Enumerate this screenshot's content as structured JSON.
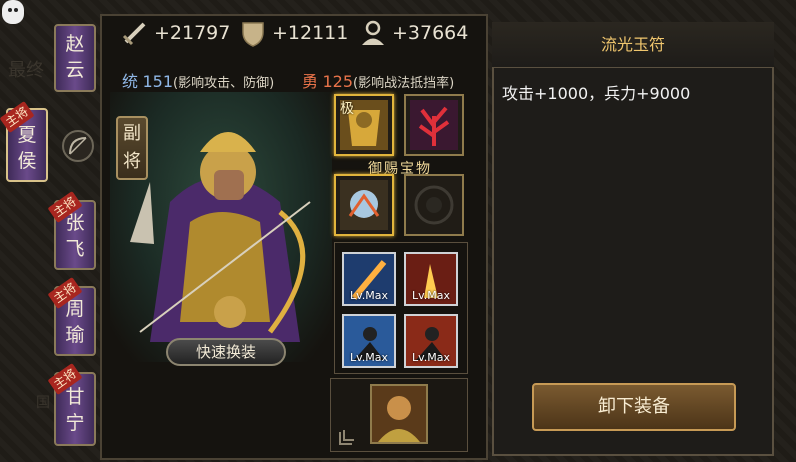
{
  "stats": {
    "attack": "+21797",
    "defense": "+12111",
    "troops": "+37664"
  },
  "attributes": {
    "command_label": "统",
    "command_value": "151",
    "command_desc": "(影响攻击、防御)",
    "valor_label": "勇",
    "valor_value": "125",
    "valor_desc": "(影响战法抵挡率)"
  },
  "sidebar": {
    "heroes": [
      {
        "name_top": "赵",
        "name_bottom": "云",
        "badge": ""
      },
      {
        "name_top": "夏",
        "name_bottom": "侯",
        "badge": "主将"
      },
      {
        "name_top": "张",
        "name_bottom": "飞",
        "badge": "主将"
      },
      {
        "name_top": "周",
        "name_bottom": "瑜",
        "badge": "主将"
      },
      {
        "name_top": "甘",
        "name_bottom": "宁",
        "badge": "主将"
      }
    ]
  },
  "background_text": {
    "word1": "最终",
    "word2": "国"
  },
  "hero": {
    "role_top": "副",
    "role_bottom": "将",
    "quick_equip_label": "快速换装"
  },
  "treasure": {
    "section_label": "御赐宝物",
    "top_slot_badge": "极"
  },
  "skills": {
    "levels": [
      "Lv.Max",
      "Lv.Max",
      "Lv.Max",
      "Lv.Max"
    ]
  },
  "detail": {
    "title": "流光玉符",
    "effect": "攻击+1000，兵力+9000",
    "unequip_label": "卸下装备"
  },
  "colors": {
    "gold": "#e2b53c",
    "command_color": "#8fb7e6",
    "valor_color": "#e8734a",
    "title_color": "#f0c66e"
  }
}
